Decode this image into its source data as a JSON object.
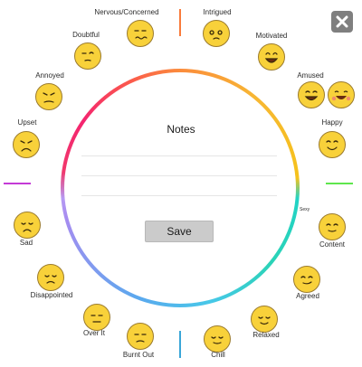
{
  "notes": {
    "title": "Notes"
  },
  "save": {
    "label": "Save"
  },
  "ring_small_label": "Sexy",
  "colors": {
    "top": "#f97b3b",
    "right": "#5ee64d",
    "bottom": "#3aa6d8",
    "left": "#c43ad6",
    "close_button_bg": "#7f7f7f",
    "emoji_fill": "#f8d13a"
  },
  "moods": [
    {
      "label": "Nervous/Concerned",
      "icon": "nervous-face-icon"
    },
    {
      "label": "Intrigued",
      "icon": "intrigued-face-icon"
    },
    {
      "label": "Motivated",
      "icon": "motivated-face-icon"
    },
    {
      "label": "Amused",
      "icon": "amused-face-icon"
    },
    {
      "label": "Happy",
      "icon": "happy-face-icon"
    },
    {
      "label": "Content",
      "icon": "content-face-icon"
    },
    {
      "label": "Agreed",
      "icon": "agreed-face-icon"
    },
    {
      "label": "Relaxed",
      "icon": "relaxed-face-icon"
    },
    {
      "label": "Chill",
      "icon": "chill-face-icon"
    },
    {
      "label": "Burnt Out",
      "icon": "burnt-out-face-icon"
    },
    {
      "label": "Over It",
      "icon": "over-it-face-icon"
    },
    {
      "label": "Disappointed",
      "icon": "disappointed-face-icon"
    },
    {
      "label": "Sad",
      "icon": "sad-face-icon"
    },
    {
      "label": "Upset",
      "icon": "upset-face-icon"
    },
    {
      "label": "Annoyed",
      "icon": "annoyed-face-icon"
    },
    {
      "label": "Doubtful",
      "icon": "doubtful-face-icon"
    }
  ],
  "extra_icon": "laughing-face-icon"
}
